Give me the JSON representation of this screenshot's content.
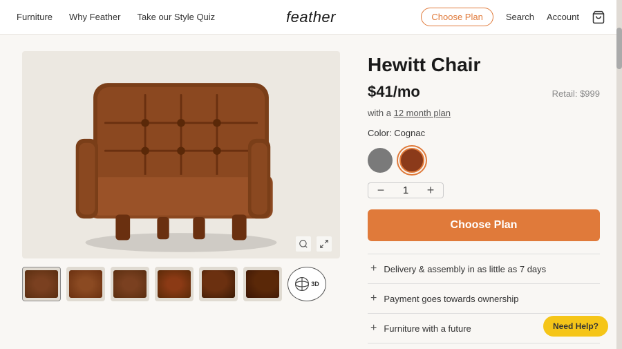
{
  "nav": {
    "links": [
      "Furniture",
      "Why Feather",
      "Take our Style Quiz"
    ],
    "logo": "feather",
    "right_links": [
      "Search",
      "Account"
    ],
    "choose_plan_label": "Choose Plan"
  },
  "product": {
    "title": "Hewitt Chair",
    "price": "$41/mo",
    "plan_note": "with a",
    "plan_link": "12 month plan",
    "retail_label": "Retail: $999",
    "color_label": "Color: Cognac",
    "quantity": 1,
    "swatches": [
      {
        "name": "gray",
        "class": "swatch-gray"
      },
      {
        "name": "cognac",
        "class": "swatch-cognac",
        "selected": true
      }
    ],
    "cta_label": "Choose Plan",
    "accordion": [
      "Delivery & assembly in as little as 7 days",
      "Payment goes towards ownership",
      "Furniture with a future"
    ]
  },
  "help_button": "Need Help?",
  "thumbnails": [
    "th1",
    "th2",
    "th3",
    "th4",
    "th5",
    "th6"
  ],
  "view_3d": "3D"
}
